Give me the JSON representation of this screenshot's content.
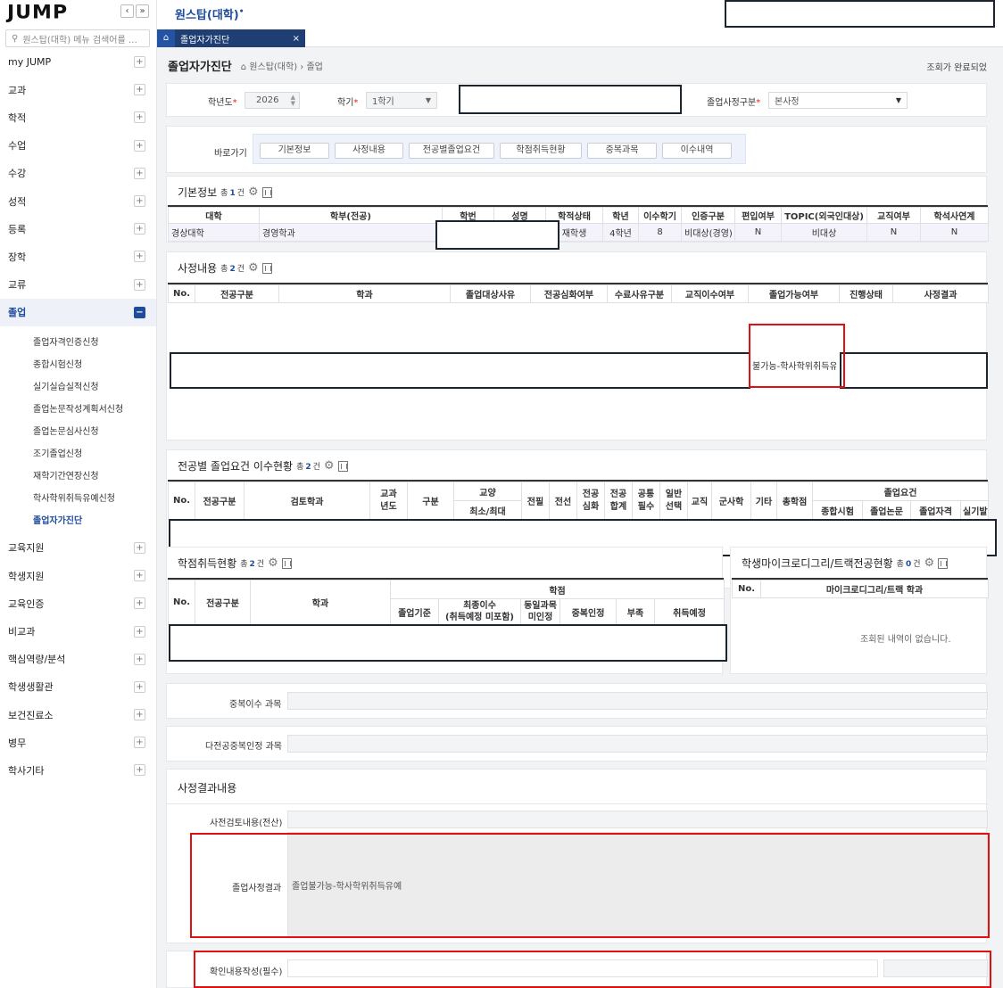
{
  "brand": {
    "logo": "JUMP"
  },
  "sidebar": {
    "collapse_left": "‹",
    "collapse_right": "»",
    "search_placeholder": "원스탑(대학) 메뉴 검색어를 …",
    "items": [
      {
        "label": "my JUMP"
      },
      {
        "label": "교과"
      },
      {
        "label": "학적"
      },
      {
        "label": "수업"
      },
      {
        "label": "수강"
      },
      {
        "label": "성적"
      },
      {
        "label": "등록"
      },
      {
        "label": "장학"
      },
      {
        "label": "교류"
      }
    ],
    "active_item": {
      "label": "졸업"
    },
    "sub_items": [
      {
        "label": "졸업자격인증신청"
      },
      {
        "label": "종합시험신청"
      },
      {
        "label": "실기실습실적신청"
      },
      {
        "label": "졸업논문작성계획서신청"
      },
      {
        "label": "졸업논문심사신청"
      },
      {
        "label": "조기졸업신청"
      },
      {
        "label": "재학기간연장신청"
      },
      {
        "label": "학사학위취득유예신청"
      }
    ],
    "current_sub": {
      "label": "졸업자가진단"
    },
    "items_after": [
      {
        "label": "교육지원"
      },
      {
        "label": "학생지원"
      },
      {
        "label": "교육인증"
      },
      {
        "label": "비교과"
      },
      {
        "label": "핵심역량/분석"
      },
      {
        "label": "학생생활관"
      },
      {
        "label": "보건진료소"
      },
      {
        "label": "병무"
      },
      {
        "label": "학사기타"
      }
    ]
  },
  "top": {
    "app_title": "원스탑(대학)"
  },
  "tabs": {
    "active_tab": "졸업자가진단",
    "close": "×"
  },
  "page": {
    "title": "졸업자가진단",
    "breadcrumb": "원스탑(대학) › 졸업",
    "status": "조회가 완료되었"
  },
  "filters": {
    "year_label": "학년도",
    "year_value": "2026",
    "term_label": "학기",
    "term_value": "1학기",
    "division_label": "졸업사정구분",
    "division_value": "본사정",
    "required_mark": "*"
  },
  "shortcuts": {
    "label": "바로가기",
    "buttons": [
      "기본정보",
      "사정내용",
      "전공별졸업요건",
      "학점취득현황",
      "중복과목",
      "이수내역"
    ]
  },
  "basic_info": {
    "title": "기본정보",
    "count_prefix": "총",
    "count": "1",
    "count_suffix": "건",
    "headers": [
      "대학",
      "학부(전공)",
      "학번",
      "성명",
      "학적상태",
      "학년",
      "이수학기",
      "인증구분",
      "편입여부",
      "TOPIC(외국인대상)",
      "교직여부",
      "학석사연계"
    ],
    "row": [
      "경상대학",
      "경영학과",
      "",
      "",
      "재학생",
      "4학년",
      "8",
      "비대상(경영)",
      "N",
      "비대상",
      "N",
      "N"
    ]
  },
  "assessment": {
    "title": "사정내용",
    "count": "2",
    "headers": [
      "No.",
      "전공구분",
      "학과",
      "졸업대상사유",
      "전공심화여부",
      "수료사유구분",
      "교직이수여부",
      "졸업가능여부",
      "진행상태",
      "사정결과"
    ],
    "visible_cell": "불가능-학사학위취득유"
  },
  "major_req": {
    "title": "전공별 졸업요건 이수현황",
    "count": "2",
    "headers": {
      "no": "No.",
      "major_type": "전공구분",
      "review_dept": "검토학과",
      "curr_year": "교과\n년도",
      "type": "구분",
      "liberal": "교양",
      "liberal_sub": "최소/최대",
      "major_req": "전필",
      "major_elec": "전선",
      "major_adv": "전공\n심화",
      "major_total": "전공\n합계",
      "common_req": "공통\n필수",
      "general_elec": "일반\n선택",
      "teaching": "교직",
      "military": "군사학",
      "etc": "기타",
      "total": "총학점",
      "grad_req": "졸업요건",
      "comp_exam": "종합시험",
      "thesis": "졸업논문",
      "cert": "졸업자격",
      "practice": "실기발"
    }
  },
  "credits": {
    "title": "학점취득현황",
    "count": "2",
    "headers": {
      "no": "No.",
      "major_type": "전공구분",
      "dept": "학과",
      "credit": "학점",
      "standard": "졸업기준",
      "final": "최종이수\n(취득예정 미포함)",
      "same_course": "동일과목\n미인정",
      "dup": "중복인정",
      "lack": "부족",
      "expected": "취득예정"
    }
  },
  "micro": {
    "title": "학생마이크로디그리/트랙전공현황",
    "count": "0",
    "headers": {
      "no": "No.",
      "dept": "마이크로디그리/트랙 학과"
    },
    "empty": "조회된 내역이 없습니다."
  },
  "duplicates": {
    "label": "중복이수 과목"
  },
  "multi_major": {
    "label": "다전공중복인정 과목"
  },
  "result_section": {
    "title": "사정결과내용",
    "pre_review_label": "사전검토내용(전산)",
    "result_label": "졸업사정결과",
    "result_value": "졸업불가능-학사학위취득유예",
    "confirm_label": "확인내용작성(필수)"
  },
  "colors": {
    "accent": "#1e4c9a",
    "highlight": "#e01010",
    "redaction": "#1c2430"
  }
}
